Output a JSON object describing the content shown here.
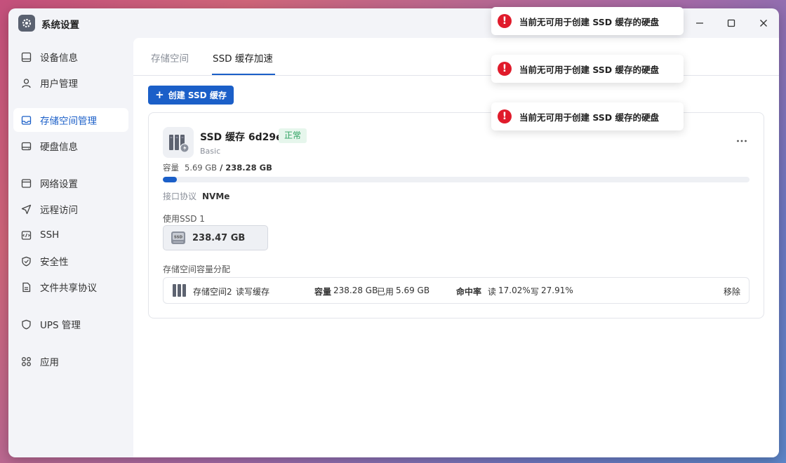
{
  "window": {
    "title": "系统设置"
  },
  "sidebar": {
    "items": [
      {
        "label": "设备信息",
        "icon": "device-info-icon"
      },
      {
        "label": "用户管理",
        "icon": "user-icon"
      },
      {
        "label": "存储空间管理",
        "icon": "storage-icon",
        "active": true
      },
      {
        "label": "硬盘信息",
        "icon": "hard-disk-icon"
      },
      {
        "label": "网络设置",
        "icon": "network-icon"
      },
      {
        "label": "远程访问",
        "icon": "remote-access-icon"
      },
      {
        "label": "SSH",
        "icon": "ssh-icon"
      },
      {
        "label": "安全性",
        "icon": "shield-icon"
      },
      {
        "label": "文件共享协议",
        "icon": "file-share-icon"
      },
      {
        "label": "UPS 管理",
        "icon": "ups-shield-icon"
      },
      {
        "label": "应用",
        "icon": "apps-icon"
      }
    ]
  },
  "tabs": [
    {
      "label": "存储空间",
      "active": false
    },
    {
      "label": "SSD 缓存加速",
      "active": true
    }
  ],
  "toolbar": {
    "create_label": "创建 SSD 缓存"
  },
  "cache": {
    "name": "SSD 缓存 6d29e",
    "status": "正常",
    "type": "Basic",
    "capacity_label": "容量",
    "used": "5.69 GB",
    "total": "238.28 GB",
    "usage_fraction": 0.024,
    "interface_label": "接口协议",
    "interface": "NVMe",
    "use_label": "使用SSD 1",
    "disk_size": "238.47 GB",
    "alloc_label": "存储空间容量分配",
    "alloc": {
      "volume": "存储空间2",
      "mode": "读写缓存",
      "capacity_label": "容量",
      "capacity": "238.28 GB",
      "used_label": "已用",
      "used": "5.69 GB",
      "hit_label": "命中率",
      "read_label": "读",
      "read": "17.02%",
      "write_label": "写",
      "write": "27.91%",
      "remove_label": "移除"
    }
  },
  "toasts": [
    {
      "message": "当前无可用于创建 SSD 缓存的硬盘"
    },
    {
      "message": "当前无可用于创建 SSD 缓存的硬盘"
    },
    {
      "message": "当前无可用于创建 SSD 缓存的硬盘"
    }
  ],
  "colors": {
    "accent": "#1b5fc8",
    "success": "#2ca160",
    "error": "#e01b2b"
  }
}
